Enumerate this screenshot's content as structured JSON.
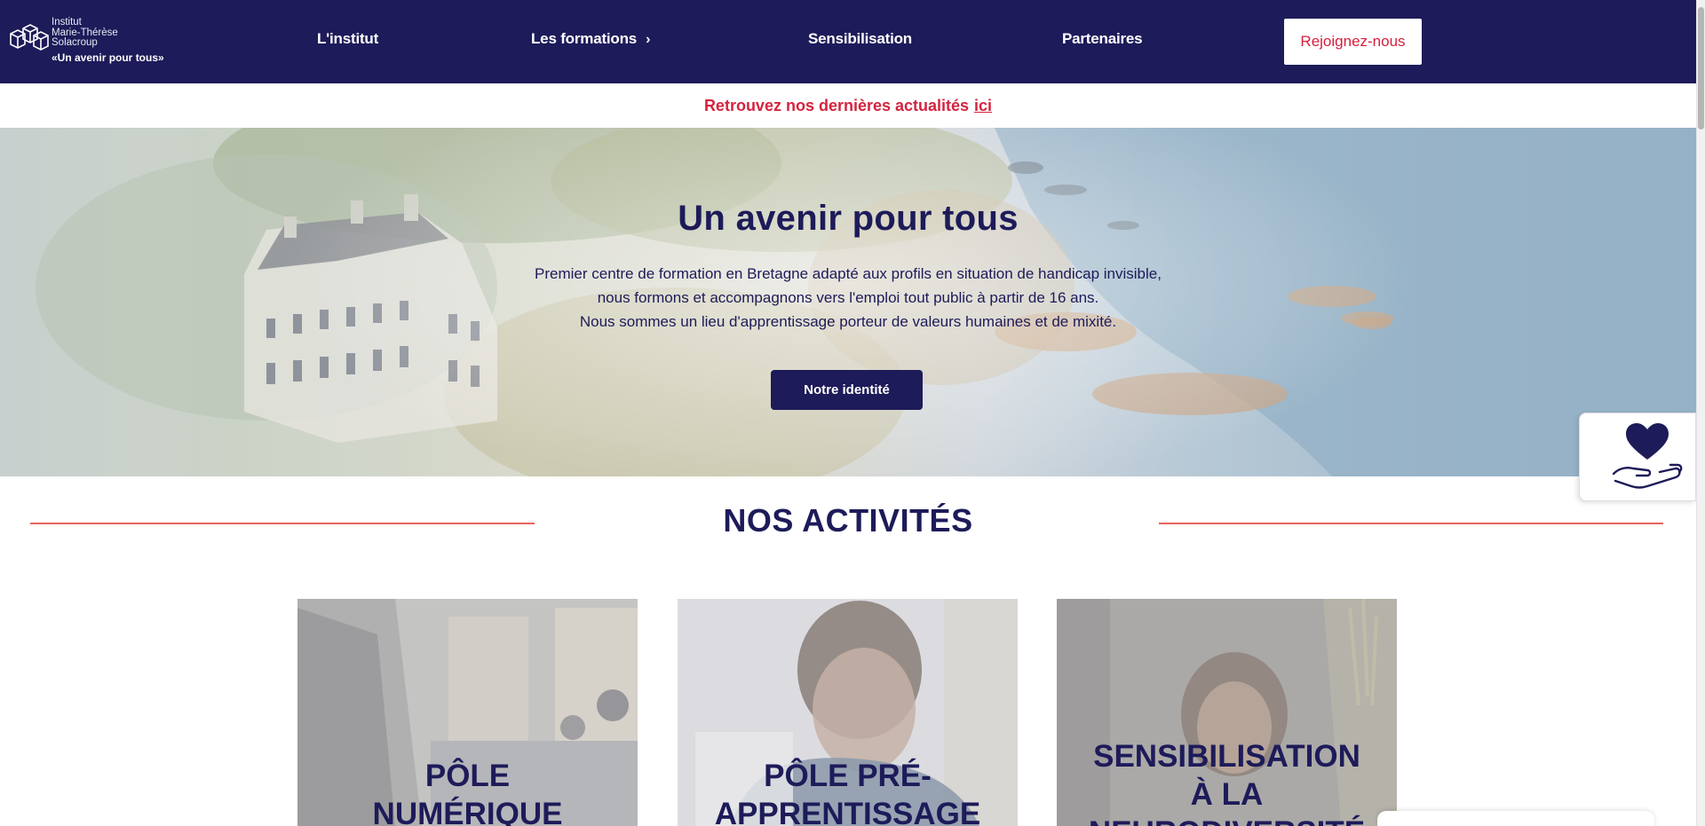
{
  "logo": {
    "line1": "Institut",
    "line2": "Marie-Thérèse",
    "line3": "Solacroup",
    "tagline": "«Un avenir pour tous»"
  },
  "nav": {
    "items": [
      {
        "label": "L'institut"
      },
      {
        "label": "Les formations",
        "chevron": "›"
      },
      {
        "label": "Sensibilisation"
      },
      {
        "label": "Partenaires"
      }
    ],
    "join_label": "Rejoignez-nous"
  },
  "banner": {
    "text": "Retrouvez nos dernières actualités",
    "link": "ici"
  },
  "hero": {
    "title": "Un avenir pour tous",
    "lines": [
      "Premier centre de formation en Bretagne adapté aux profils en situation de handicap invisible,",
      "nous formons et accompagnons vers l'emploi tout public à partir de 16 ans.",
      "Nous sommes un lieu d'apprentissage porteur de valeurs humaines et de mixité."
    ],
    "button_label": "Notre identité"
  },
  "activities": {
    "title": "NOS ACTIVITÉS",
    "cards": [
      {
        "line1": "PÔLE",
        "line2": "NUMÉRIQUE"
      },
      {
        "line1": "PÔLE PRÉ-",
        "line2": "APPRENTISSAGE"
      },
      {
        "line1": "SENSIBILISATION",
        "line2": "À LA",
        "line3": "NEURODIVERSITÉ"
      }
    ]
  },
  "side_widget": {
    "icon": "heart-hand-icon"
  },
  "colors": {
    "navy": "#1d1b59",
    "red": "#d4243f",
    "rule": "#e8625d"
  }
}
